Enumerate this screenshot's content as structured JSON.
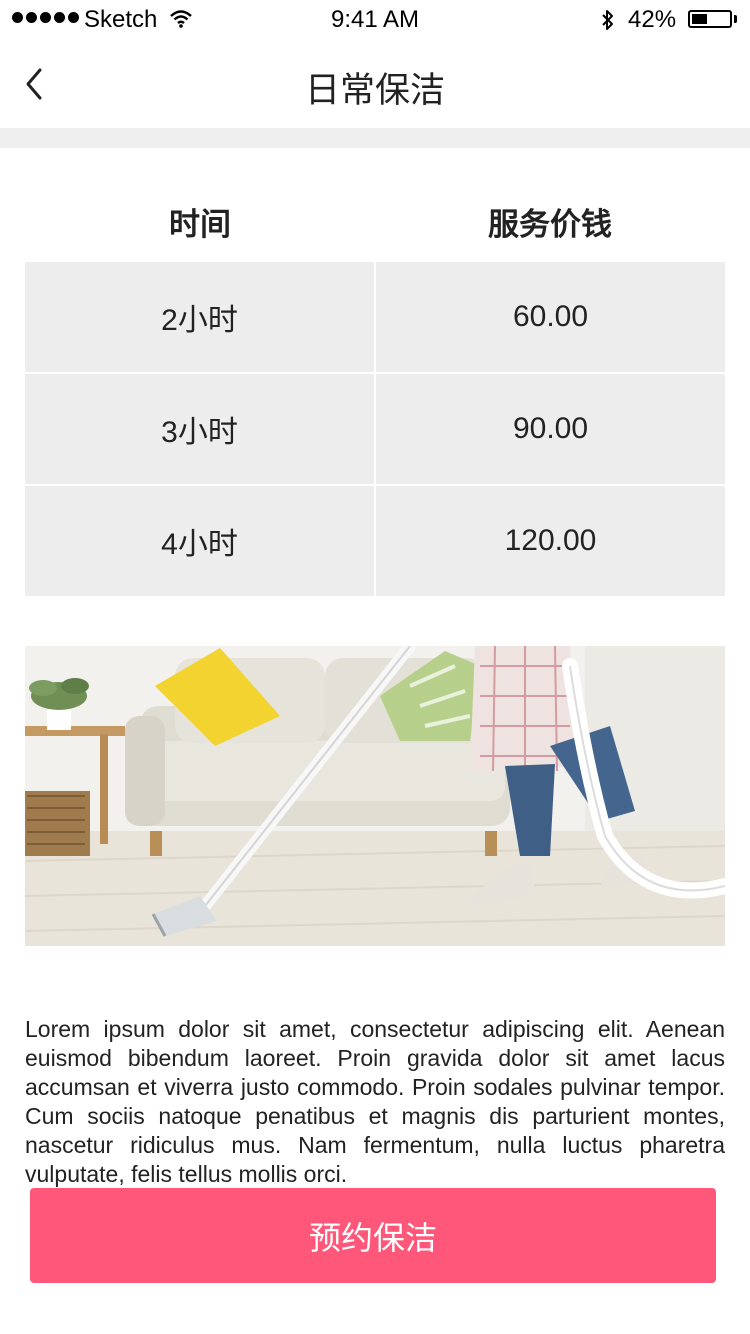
{
  "status_bar": {
    "carrier": "Sketch",
    "time": "9:41 AM",
    "battery_percent": "42%",
    "battery_level": 0.42,
    "icons": [
      "signal-dots",
      "wifi-icon",
      "bluetooth-icon",
      "battery-icon"
    ]
  },
  "nav": {
    "title": "日常保洁",
    "back_icon": "chevron-left-icon"
  },
  "price_table": {
    "headers": [
      "时间",
      "服务价钱"
    ],
    "rows": [
      {
        "duration": "2小时",
        "price": "60.00"
      },
      {
        "duration": "3小时",
        "price": "90.00"
      },
      {
        "duration": "4小时",
        "price": "120.00"
      }
    ]
  },
  "photo": {
    "subject": "person vacuuming floor in living room with sofa"
  },
  "description": "Lorem ipsum dolor sit amet, consectetur adipiscing elit. Aenean euismod bibendum laoreet. Proin gravida dolor sit amet lacus accumsan et viverra justo commodo. Proin sodales pulvinar tempor. Cum sociis natoque penatibus et magnis dis parturient montes, nascetur ridiculus mus. Nam fermentum, nulla luctus pharetra vulputate, felis tellus mollis orci.",
  "cta": {
    "label": "预约保洁",
    "color": "#ff5779"
  },
  "colors": {
    "table_cell_bg": "#ededed",
    "separator": "#efefef"
  }
}
